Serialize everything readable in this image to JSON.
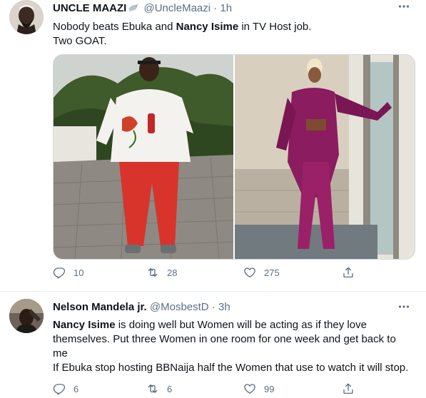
{
  "colors": {
    "accent": "#1da1f2",
    "muted": "#5b7083",
    "text": "#0f1419",
    "divider": "#e6ecf0"
  },
  "tweets": [
    {
      "display_name": "UNCLE MAAZI",
      "handle": "@UncleMaazi",
      "time": "1h",
      "separator": "·",
      "name_emoji_icon": "dove-icon",
      "text_segments": [
        "Nobody beats Ebuka and ",
        "Nancy Isime",
        " in TV Host job."
      ],
      "text_line2": "Two GOAT.",
      "media": [
        {
          "alt": "man in white printed shirt and red track pants holding a drink bottle"
        },
        {
          "alt": "woman in purple suit posing by a window"
        }
      ],
      "reply_count": "10",
      "retweet_count": "28",
      "like_count": "275"
    },
    {
      "display_name": "Nelson Mandela jr.",
      "handle": "@MosbestD",
      "time": "3h",
      "separator": "·",
      "text_segments": [
        "Nancy Isime",
        " is doing well but Women will be acting as if they love themselves. Put three Women in one room for one week and get back to me"
      ],
      "text_paragraph2": "If Ebuka stop hosting BBNaija half the Women that use to watch it will stop.",
      "reply_count": "6",
      "retweet_count": "6",
      "like_count": "99"
    }
  ]
}
